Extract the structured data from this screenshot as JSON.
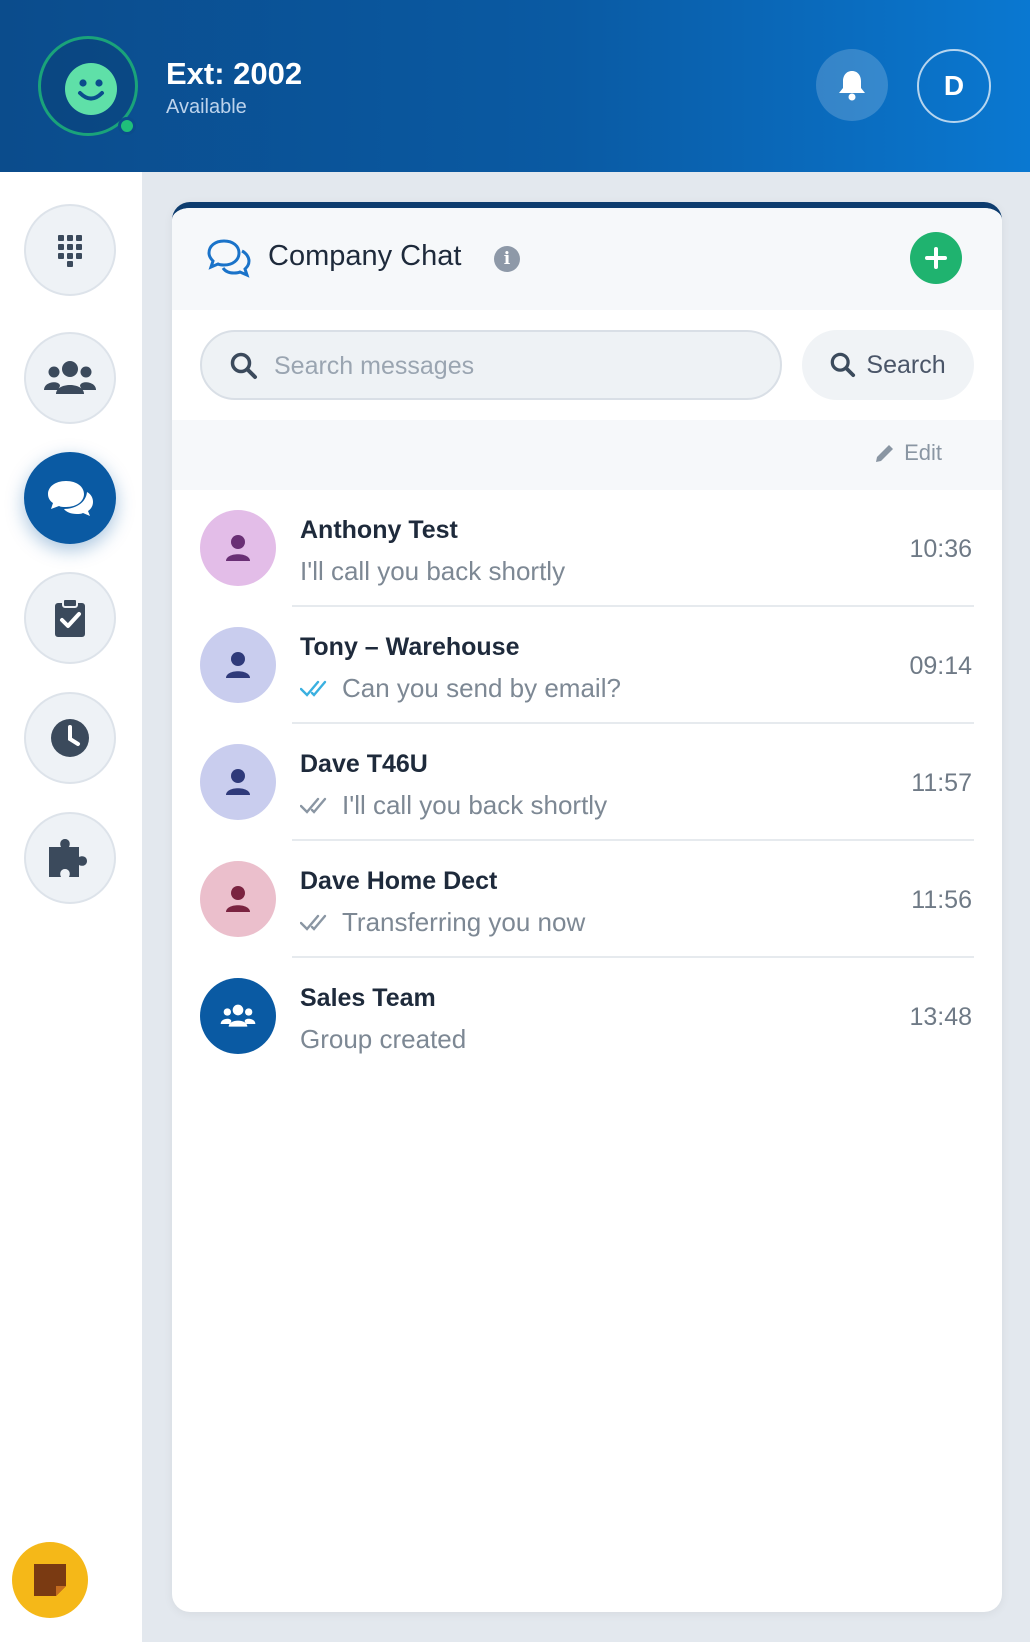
{
  "header": {
    "extension": "Ext: 2002",
    "status": "Available",
    "profile_initial": "D"
  },
  "sidebar": {
    "items": [
      {
        "name": "dialpad",
        "icon": "dialpad-icon",
        "active": false
      },
      {
        "name": "contacts",
        "icon": "users-icon",
        "active": false
      },
      {
        "name": "chat",
        "icon": "chat-bubbles-icon",
        "active": true
      },
      {
        "name": "tasks",
        "icon": "clipboard-check-icon",
        "active": false
      },
      {
        "name": "history",
        "icon": "clock-icon",
        "active": false
      },
      {
        "name": "integrations",
        "icon": "puzzle-icon",
        "active": false
      }
    ],
    "notes_icon": "sticky-note-icon"
  },
  "chat": {
    "title": "Company Chat",
    "search_placeholder": "Search messages",
    "search_value": "",
    "search_button": "Search",
    "edit_label": "Edit",
    "conversations": [
      {
        "name": "Anthony Test",
        "message": "I'll call you back shortly",
        "time": "10:36",
        "ticks": "none",
        "avatar_bg": "#e3bde8",
        "avatar_fg": "#6a2f75"
      },
      {
        "name": "Tony – Warehouse",
        "message": "Can you send by email?",
        "time": "09:14",
        "ticks": "read",
        "avatar_bg": "#c9cdee",
        "avatar_fg": "#2f3a7a"
      },
      {
        "name": "Dave T46U",
        "message": "I'll call you back shortly",
        "time": "11:57",
        "ticks": "delivered",
        "avatar_bg": "#c9cdee",
        "avatar_fg": "#2f3a7a"
      },
      {
        "name": "Dave Home Dect",
        "message": "Transferring you now",
        "time": "11:56",
        "ticks": "delivered",
        "avatar_bg": "#ebbfcc",
        "avatar_fg": "#7a2340"
      },
      {
        "name": "Sales Team",
        "message": "Group created",
        "time": "13:48",
        "ticks": "none",
        "avatar_bg": "#0a5aa3",
        "avatar_fg": "#ffffff",
        "group": true
      }
    ]
  },
  "colors": {
    "header_dark": "#0b4c8c",
    "header_light": "#0a78d1",
    "accent_green": "#1fb36f",
    "active_nav": "#0a5aa3",
    "notes_yellow": "#f5b818",
    "read_tick": "#3ab0e0",
    "delivered_tick": "#8a96a3"
  }
}
